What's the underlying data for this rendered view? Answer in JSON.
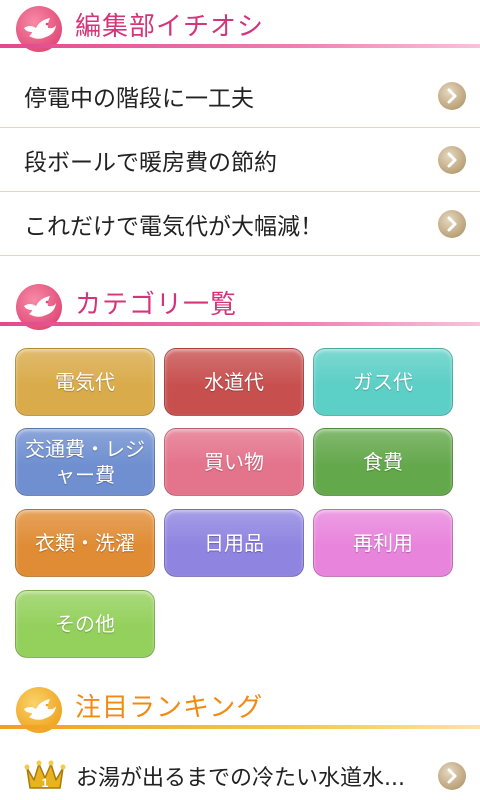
{
  "editor_picks": {
    "title": "編集部イチオシ",
    "items": [
      {
        "label": "停電中の階段に一工夫"
      },
      {
        "label": "段ボールで暖房費の節約"
      },
      {
        "label": "これだけで電気代が大幅減！"
      }
    ]
  },
  "categories": {
    "title": "カテゴリ一覧",
    "items": [
      {
        "label": "電気代",
        "color": "#d9ab4a"
      },
      {
        "label": "水道代",
        "color": "#c7504f"
      },
      {
        "label": "ガス代",
        "color": "#5ccfc6"
      },
      {
        "label": "交通費・レジャー費",
        "color": "#6f8fd0"
      },
      {
        "label": "買い物",
        "color": "#e4738c"
      },
      {
        "label": "食費",
        "color": "#64a84c"
      },
      {
        "label": "衣類・洗濯",
        "color": "#e08c34"
      },
      {
        "label": "日用品",
        "color": "#8f84e0"
      },
      {
        "label": "再利用",
        "color": "#e884dc"
      },
      {
        "label": "その他",
        "color": "#94d05c"
      }
    ]
  },
  "ranking": {
    "title": "注目ランキング",
    "items": [
      {
        "rank": "1",
        "label": "お湯が出るまでの冷たい水道水..."
      }
    ]
  },
  "colors": {
    "accent_pink": "#d4357a",
    "accent_orange": "#f28a12"
  },
  "icons": {
    "header_pink": "bird-pink-icon",
    "header_orange": "bird-orange-icon",
    "row_arrow": "chevron-right-icon",
    "rank": "crown-icon"
  }
}
